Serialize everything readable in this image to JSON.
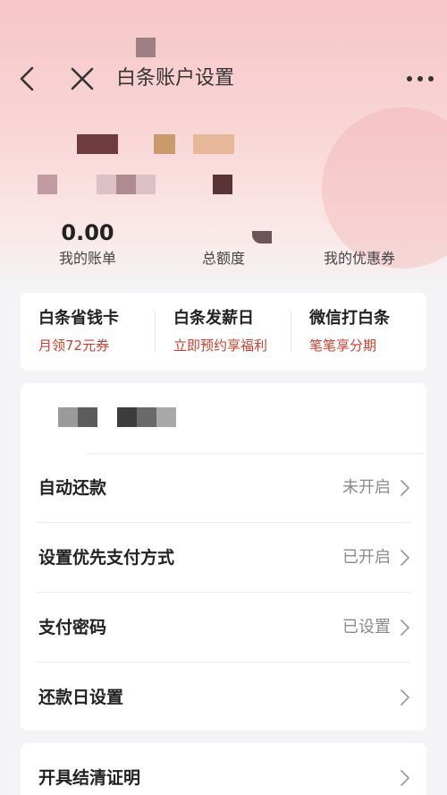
{
  "header": {
    "title": "白条账户设置"
  },
  "summary": {
    "bill_value": "0.00",
    "bill_label": "我的账单",
    "limit_label": "总额度",
    "coupon_label": "我的优惠券"
  },
  "promos": [
    {
      "title": "白条省钱卡",
      "subtitle": "月领72元券"
    },
    {
      "title": "白条发薪日",
      "subtitle": "立即预约享福利"
    },
    {
      "title": "微信打白条",
      "subtitle": "笔笔享分期"
    }
  ],
  "settings": [
    {
      "label": "自动还款",
      "value": "未开启"
    },
    {
      "label": "设置优先支付方式",
      "value": "已开启"
    },
    {
      "label": "支付密码",
      "value": "已设置"
    },
    {
      "label": "还款日设置",
      "value": ""
    }
  ],
  "certificate": {
    "label": "开具结清证明"
  },
  "colors": {
    "accent": "#c8402e",
    "hero_top": "#f6c6c8",
    "background": "#f4f4f6"
  }
}
